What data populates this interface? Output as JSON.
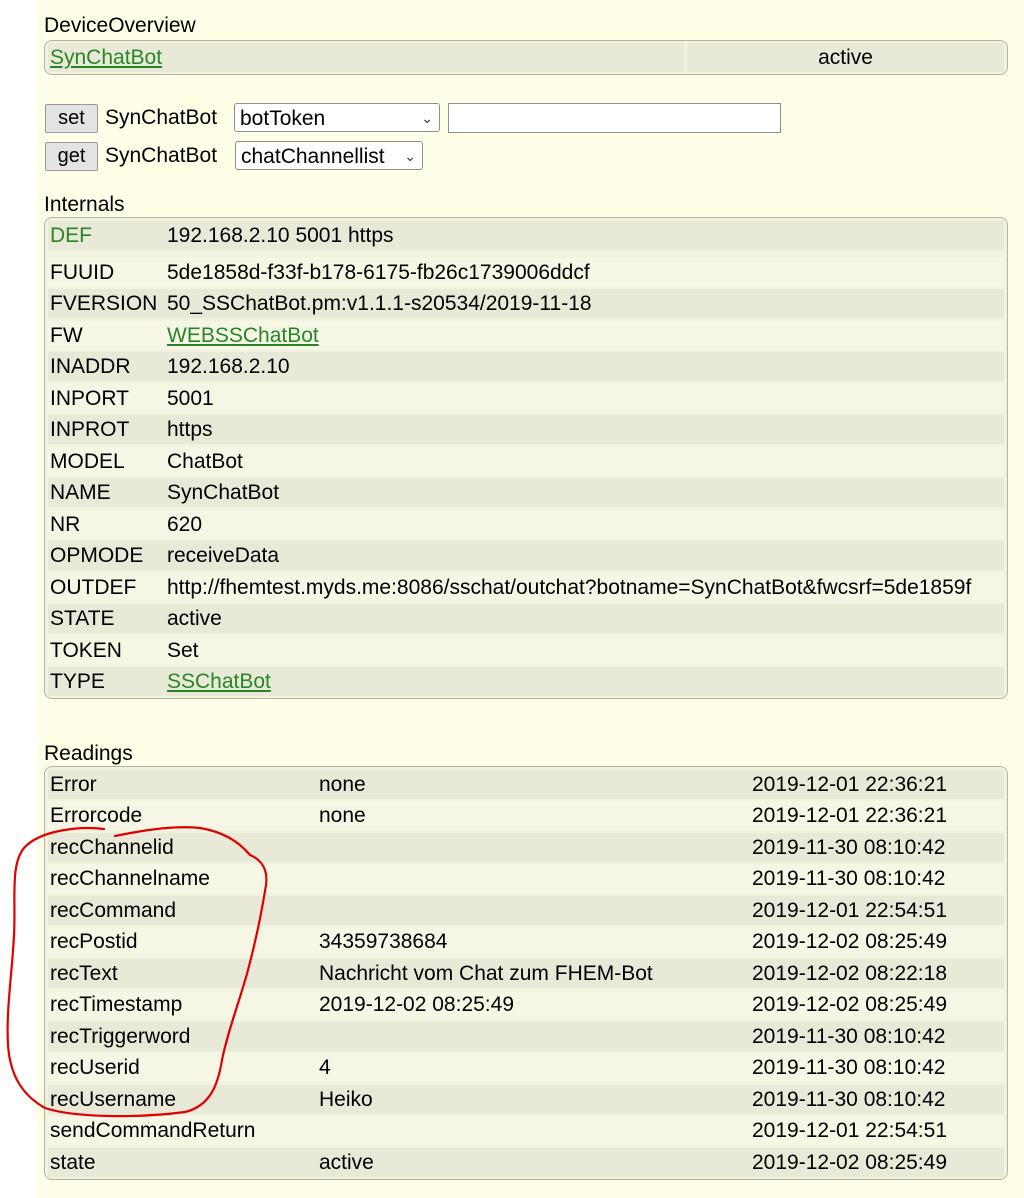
{
  "device_overview": {
    "title": "DeviceOverview",
    "device_name": "SynChatBot",
    "state": "active"
  },
  "commands": {
    "set": {
      "button_label": "set",
      "device": "SynChatBot",
      "selected_option": "botToken",
      "input_value": ""
    },
    "get": {
      "button_label": "get",
      "device": "SynChatBot",
      "selected_option": "chatChannellist"
    }
  },
  "internals": {
    "title": "Internals",
    "rows": [
      {
        "key": "DEF",
        "value": "192.168.2.10 5001 https"
      },
      {
        "key": "FUUID",
        "value": "5de1858d-f33f-b178-6175-fb26c1739006ddcf"
      },
      {
        "key": "FVERSION",
        "value": "50_SSChatBot.pm:v1.1.1-s20534/2019-11-18"
      },
      {
        "key": "FW",
        "value": "WEBSSChatBot"
      },
      {
        "key": "INADDR",
        "value": "192.168.2.10"
      },
      {
        "key": "INPORT",
        "value": "5001"
      },
      {
        "key": "INPROT",
        "value": "https"
      },
      {
        "key": "MODEL",
        "value": "ChatBot"
      },
      {
        "key": "NAME",
        "value": "SynChatBot"
      },
      {
        "key": "NR",
        "value": "620"
      },
      {
        "key": "OPMODE",
        "value": "receiveData"
      },
      {
        "key": "OUTDEF",
        "value": "http://fhemtest.myds.me:8086/sschat/outchat?botname=SynChatBot&fwcsrf=5de1859f"
      },
      {
        "key": "STATE",
        "value": "active"
      },
      {
        "key": "TOKEN",
        "value": "Set"
      },
      {
        "key": "TYPE",
        "value": "SSChatBot"
      }
    ]
  },
  "readings": {
    "title": "Readings",
    "rows": [
      {
        "key": "Error",
        "value": "none",
        "time": "2019-12-01 22:36:21"
      },
      {
        "key": "Errorcode",
        "value": "none",
        "time": "2019-12-01 22:36:21"
      },
      {
        "key": "recChannelid",
        "value": "",
        "time": "2019-11-30 08:10:42"
      },
      {
        "key": "recChannelname",
        "value": "",
        "time": "2019-11-30 08:10:42"
      },
      {
        "key": "recCommand",
        "value": "",
        "time": "2019-12-01 22:54:51"
      },
      {
        "key": "recPostid",
        "value": "34359738684",
        "time": "2019-12-02 08:25:49"
      },
      {
        "key": "recText",
        "value": "Nachricht vom Chat zum FHEM-Bot",
        "time": "2019-12-02 08:22:18"
      },
      {
        "key": "recTimestamp",
        "value": "2019-12-02 08:25:49",
        "time": "2019-12-02 08:25:49"
      },
      {
        "key": "recTriggerword",
        "value": "",
        "time": "2019-11-30 08:10:42"
      },
      {
        "key": "recUserid",
        "value": "4",
        "time": "2019-11-30 08:10:42"
      },
      {
        "key": "recUsername",
        "value": "Heiko",
        "time": "2019-11-30 08:10:42"
      },
      {
        "key": "sendCommandReturn",
        "value": "",
        "time": "2019-12-01 22:54:51"
      },
      {
        "key": "state",
        "value": "active",
        "time": "2019-12-02 08:25:49"
      }
    ]
  },
  "colors": {
    "panel_background": "#ffffe8",
    "link": "#278727",
    "annotation_stroke": "#e00000"
  }
}
